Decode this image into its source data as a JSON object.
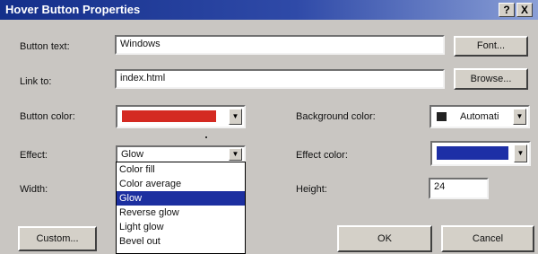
{
  "window": {
    "title": "Hover Button Properties",
    "help_label": "?",
    "close_label": "X"
  },
  "labels": {
    "button_text": "Button text:",
    "link_to": "Link to:",
    "button_color": "Button color:",
    "background_color": "Background color:",
    "effect": "Effect:",
    "effect_color": "Effect color:",
    "width": "Width:",
    "height": "Height:"
  },
  "fields": {
    "button_text_value": "Windows",
    "link_to_value": "index.html",
    "effect_value": "Glow",
    "height_value": "24",
    "background_color_value": "Automati"
  },
  "buttons": {
    "font": "Font...",
    "browse": "Browse...",
    "custom": "Custom...",
    "ok": "OK",
    "cancel": "Cancel"
  },
  "effect_options": [
    "Color fill",
    "Color average",
    "Glow",
    "Reverse glow",
    "Light glow",
    "Bevel out"
  ],
  "selected_effect": "Glow",
  "colors": {
    "button_color": "#d42a22",
    "background_color_swatch": "#222222",
    "effect_color": "#1d2fa6",
    "title_bar": "#142f8a",
    "selection": "#1c2fa0"
  },
  "icons": {
    "dropdown": "chevron-down-icon"
  }
}
